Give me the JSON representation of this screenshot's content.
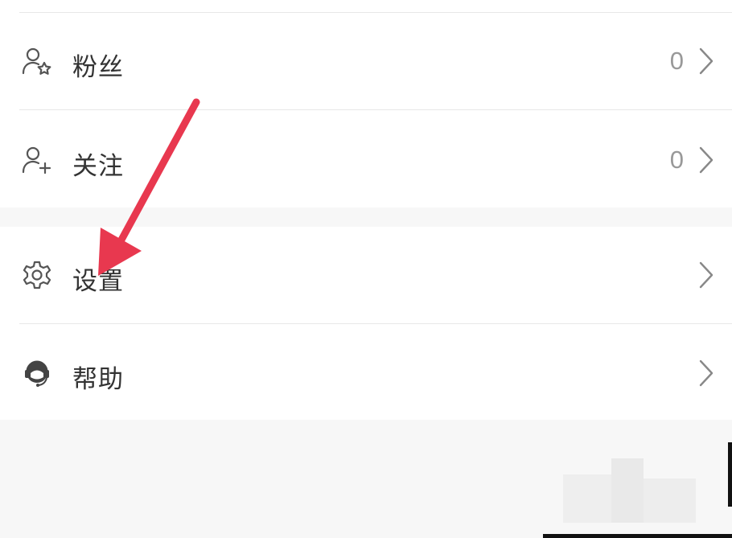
{
  "menu": {
    "group1": [
      {
        "id": "fans",
        "label": "粉丝",
        "count": "0",
        "icon": "user-star-icon"
      },
      {
        "id": "following",
        "label": "关注",
        "count": "0",
        "icon": "user-add-icon"
      }
    ],
    "group2": [
      {
        "id": "settings",
        "label": "设置",
        "icon": "gear-icon"
      },
      {
        "id": "help",
        "label": "帮助",
        "icon": "headset-icon"
      }
    ]
  },
  "colors": {
    "arrow": "#e8384f",
    "text": "#333333",
    "secondary": "#999999",
    "background": "#f7f7f7"
  }
}
